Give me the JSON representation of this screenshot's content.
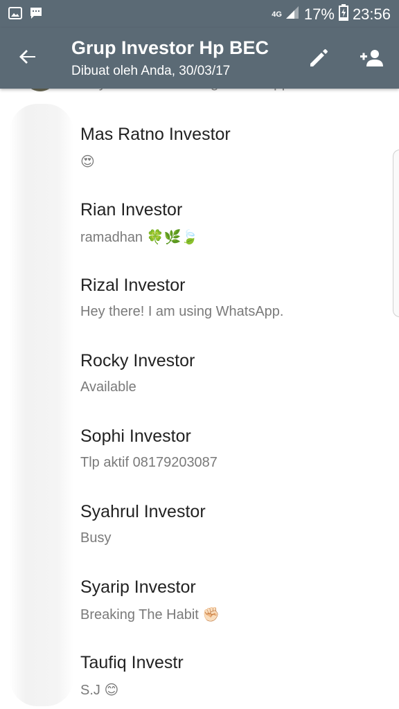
{
  "status_bar": {
    "network": "4G",
    "battery": "17%",
    "time": "23:56"
  },
  "app_bar": {
    "title": "Grup Investor Hp BEC",
    "subtitle": "Dibuat oleh Anda, 30/03/17"
  },
  "partial_row": {
    "status": "Hey there! I am using WhatsApp."
  },
  "participants": [
    {
      "name": "Mas Ratno Investor",
      "status": "😍"
    },
    {
      "name": "Rian Investor",
      "status": "ramadhan 🍀🌿🍃"
    },
    {
      "name": "Rizal Investor",
      "status": "Hey there! I am using WhatsApp."
    },
    {
      "name": "Rocky Investor",
      "status": "Available"
    },
    {
      "name": "Sophi Investor",
      "status": "Tlp aktif 08179203087"
    },
    {
      "name": "Syahrul Investor",
      "status": "Busy"
    },
    {
      "name": "Syarip Investor",
      "status": "Breaking The Habit ✊🏻"
    },
    {
      "name": "Taufiq Investr",
      "status": "S.J 😊"
    }
  ],
  "colors": {
    "toolbar": "#5b6a75",
    "name_text": "#222222",
    "status_text": "#7a7a7a"
  },
  "icons": {
    "back": "arrow-back-icon",
    "edit": "pencil-icon",
    "add_participant": "person-add-icon"
  }
}
